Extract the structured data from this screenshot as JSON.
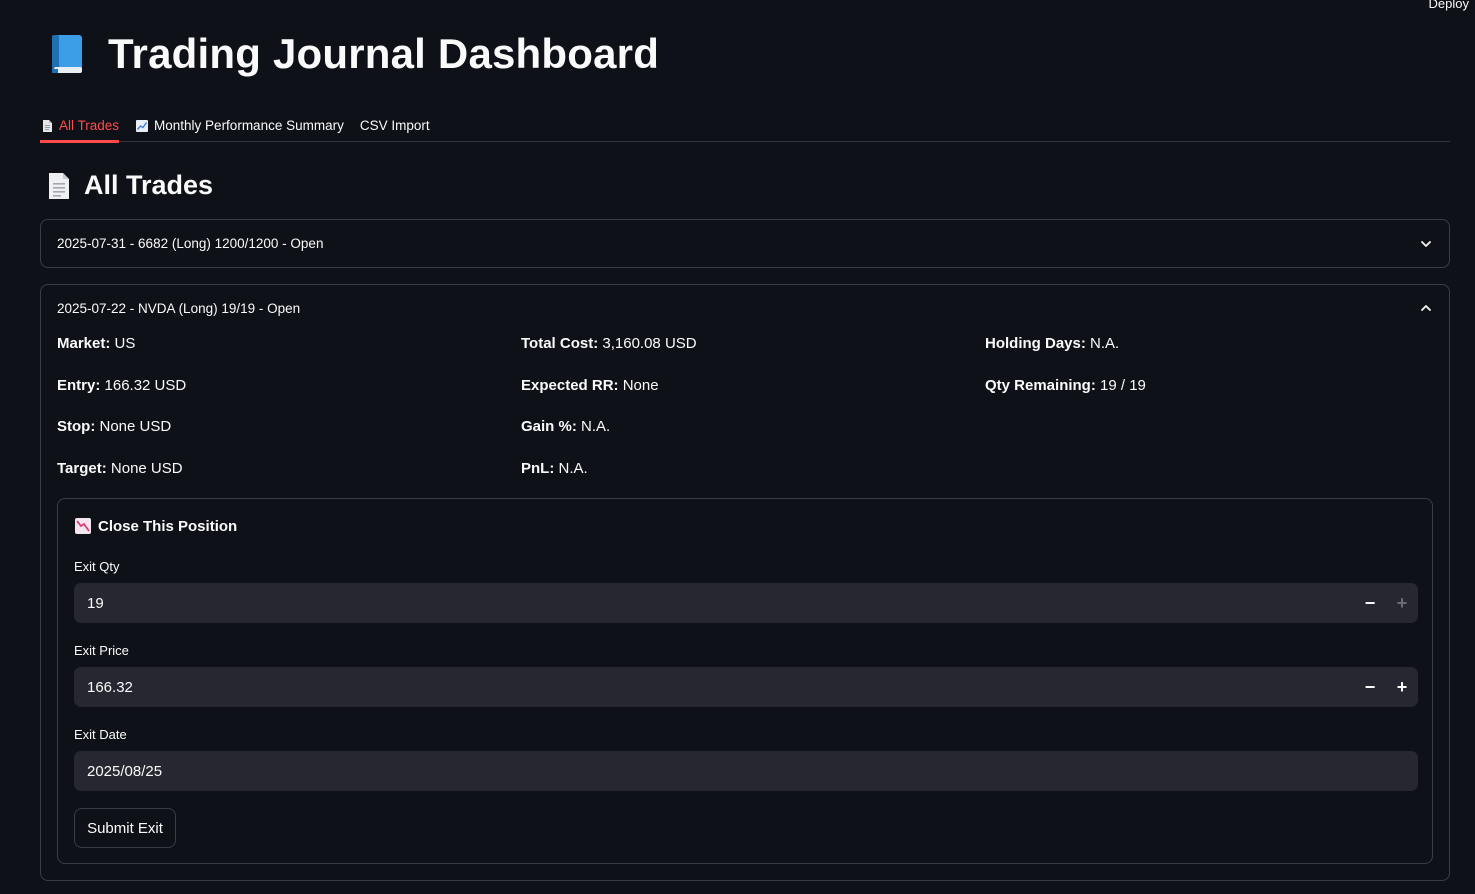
{
  "header": {
    "deploy_label": "Deploy",
    "title": "Trading Journal Dashboard"
  },
  "tabs": [
    {
      "label": "All Trades",
      "icon": "page-icon",
      "active": true
    },
    {
      "label": "Monthly Performance Summary",
      "icon": "chart-icon",
      "active": false
    },
    {
      "label": "CSV Import",
      "icon": "",
      "active": false
    }
  ],
  "section": {
    "title": "All Trades"
  },
  "trades": [
    {
      "header": "2025-07-31 - 6682 (Long) 1200/1200 - Open",
      "expanded": false
    },
    {
      "header": "2025-07-22 - NVDA (Long) 19/19 - Open",
      "expanded": true,
      "details": {
        "market_label": "Market:",
        "market": "US",
        "entry_label": "Entry:",
        "entry": "166.32 USD",
        "stop_label": "Stop:",
        "stop": "None USD",
        "target_label": "Target:",
        "target": "None USD",
        "total_cost_label": "Total Cost:",
        "total_cost": "3,160.08 USD",
        "expected_rr_label": "Expected RR:",
        "expected_rr": "None",
        "gain_label": "Gain %:",
        "gain": "N.A.",
        "pnl_label": "PnL:",
        "pnl": "N.A.",
        "holding_days_label": "Holding Days:",
        "holding_days": "N.A.",
        "qty_remaining_label": "Qty Remaining:",
        "qty_remaining": "19 / 19"
      },
      "close_form": {
        "title": "Close This Position",
        "exit_qty_label": "Exit Qty",
        "exit_qty": "19",
        "exit_price_label": "Exit Price",
        "exit_price": "166.32",
        "exit_date_label": "Exit Date",
        "exit_date": "2025/08/25",
        "minus": "−",
        "plus": "+",
        "submit_label": "Submit Exit"
      }
    }
  ],
  "colors": {
    "background": "#0e1117",
    "accent": "#ff4b4b",
    "input_bg": "#262730",
    "border": "#3a3d47"
  }
}
